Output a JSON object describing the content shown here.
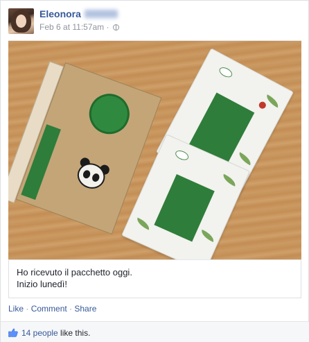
{
  "author": {
    "first_name": "Eleonora",
    "last_name_redacted": true
  },
  "post_meta": {
    "timestamp": "Feb 6 at 11:57am",
    "separator": "·",
    "privacy_icon": "globe-icon"
  },
  "photo": {
    "description_icon": "photo-image"
  },
  "caption": {
    "line1": "Ho ricevuto il pacchetto oggi.",
    "line2": "Inizio lunedì!"
  },
  "actions": {
    "like": "Like",
    "comment": "Comment",
    "share": "Share",
    "separator": " · "
  },
  "likes": {
    "icon": "thumbs-up-icon",
    "count_label": "14 people",
    "suffix": " like this."
  },
  "colors": {
    "link": "#365899",
    "muted": "#90949c",
    "text": "#1d2129",
    "footer_bg": "#f6f7f9"
  }
}
